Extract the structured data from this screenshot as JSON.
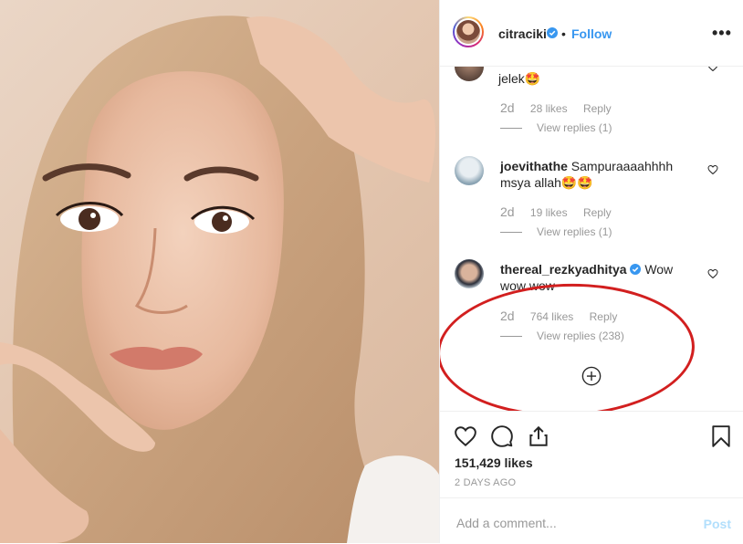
{
  "post_header": {
    "username": "citraciki",
    "separator": "•",
    "follow_label": "Follow",
    "more_label": "•••"
  },
  "comments": [
    {
      "text": "jelek🤩",
      "time": "2d",
      "likes": "28 likes",
      "reply_label": "Reply",
      "view_replies": "View replies (1)"
    },
    {
      "username": "joevithathe",
      "text": "Sampuraaaahhhh msya allah🤩🤩",
      "time": "2d",
      "likes": "19 likes",
      "reply_label": "Reply",
      "view_replies": "View replies (1)"
    },
    {
      "username": "thereal_rezkyadhitya",
      "text": "Wow wow wow",
      "time": "2d",
      "likes": "764 likes",
      "reply_label": "Reply",
      "view_replies": "View replies (238)"
    }
  ],
  "actions": {
    "likes_count": "151,429 likes",
    "time_ago": "2 DAYS AGO"
  },
  "add_comment": {
    "placeholder": "Add a comment...",
    "post_label": "Post"
  },
  "colors": {
    "accent": "#3897f0",
    "highlight": "#d21f1f",
    "verified": "#3897f0"
  },
  "icons": [
    "verified-badge-icon",
    "more-options-icon",
    "heart-icon",
    "comment-icon",
    "share-icon",
    "bookmark-icon",
    "add-circle-icon"
  ]
}
